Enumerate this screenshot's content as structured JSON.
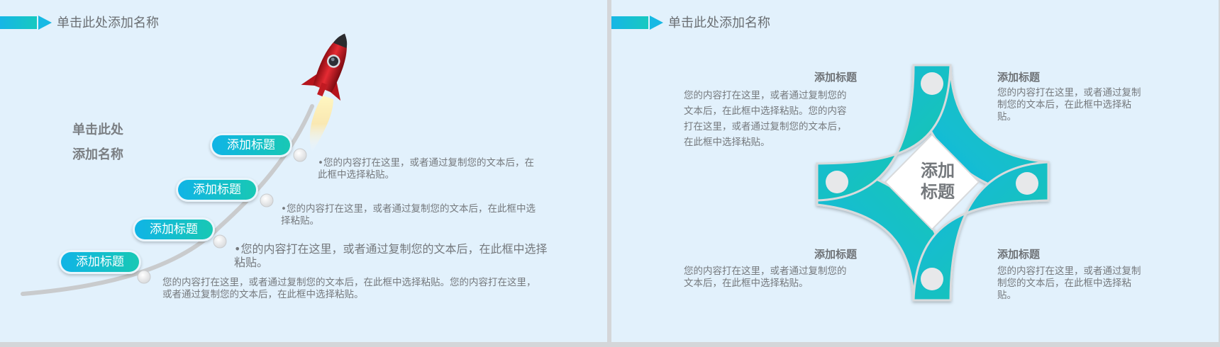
{
  "left_slide": {
    "header_title": "单击此处添加名称",
    "side_title_line1": "单击此处",
    "side_title_line2": "添加名称",
    "steps": [
      {
        "label": "添加标题",
        "text": [
          "•您的内容打在这里，或者通过复制您的文本后，在",
          "此框中选择粘贴。"
        ]
      },
      {
        "label": "添加标题",
        "text": [
          "•您的内容打在这里，或者通过复制您的文本后，在此框中选",
          "择粘贴。"
        ]
      },
      {
        "label": "添加标题",
        "text": [
          "•您的内容打在这里，或者通过复制您的文本后，在此框中选择",
          "粘贴。"
        ]
      },
      {
        "label": "添加标题",
        "text": [
          "您的内容打在这里，或者通过复制您的文本后，在此框中选择粘贴。您的内容打在这里，",
          "或者通过复制您的文本后，在此框中选择粘贴。"
        ]
      }
    ]
  },
  "right_slide": {
    "header_title": "单击此处添加名称",
    "center_line1": "添加",
    "center_line2": "标题",
    "blocks": [
      {
        "title": "添加标题",
        "text": [
          "您的内容打在这里，或者通过复制您的",
          "文本后，在此框中选择粘贴。您的内容",
          "打在这里，或者通过复制您的文本后，",
          "在此框中选择粘贴。"
        ]
      },
      {
        "title": "添加标题",
        "text": [
          "您的内容打在这里，或者通过复制",
          "制您的文本后，在此框中选择粘",
          "贴。"
        ]
      },
      {
        "title": "添加标题",
        "text": [
          "您的内容打在这里，或者通过复制您的",
          "文本后，在此框中选择粘贴。"
        ]
      },
      {
        "title": "添加标题",
        "text": [
          "您的内容打在这里，或者通过复制",
          "制您的文本后，在此框中选择粘",
          "贴。"
        ]
      }
    ]
  },
  "colors": {
    "background": "#e2f1fc",
    "accent_blue": "#10b4e6",
    "accent_teal": "#18c8b4",
    "text_gray": "#75797d",
    "rocket_red": "#d8202a"
  },
  "icons": [
    "rocket-icon"
  ]
}
